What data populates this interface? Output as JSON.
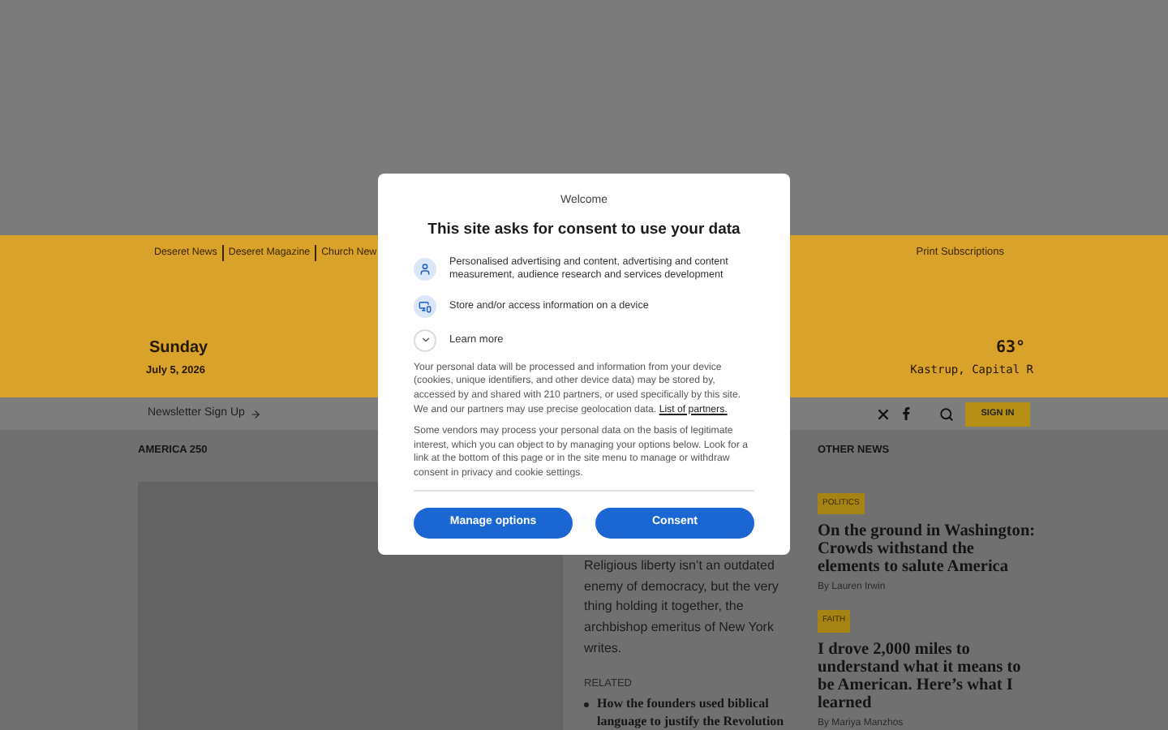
{
  "header": {
    "links": [
      "Deseret News",
      "Deseret Magazine",
      "Church New"
    ],
    "print_link": "Print Subscriptions",
    "day": "Sunday",
    "date": "July 5, 2026",
    "temperature": "63°",
    "location": "Kastrup, Capital R"
  },
  "nav": {
    "newsletter": "Newsletter Sign Up",
    "sign_in": "SIGN IN"
  },
  "main_story": {
    "section": "AMERICA 250",
    "summary": "Religious liberty isn’t an outdated enemy of democracy, but the very thing holding it together, the archbishop emeritus of New York writes.",
    "related_label": "RELATED",
    "related": [
      "How the founders used biblical language to justify the Revolution"
    ]
  },
  "other_news": {
    "title": "OTHER NEWS",
    "stories": [
      {
        "tag": "POLITICS",
        "headline": "On the ground in Washington: Crowds withstand the elements to salute America",
        "byline": "By Lauren Irwin"
      },
      {
        "tag": "FAITH",
        "headline": "I drove 2,000 miles to understand what it means to be American. Here’s what I learned",
        "byline": "By Mariya Manzhos"
      }
    ]
  },
  "consent": {
    "eyebrow": "Welcome",
    "title": "This site asks for consent to use your data",
    "purposes": [
      {
        "kind": "person",
        "text": "Personalised advertising and content, advertising and content measurement, audience research and services development"
      },
      {
        "kind": "device",
        "text": "Store and/or access information on a device"
      }
    ],
    "learn_more": {
      "label": "Learn more",
      "expanded": false
    },
    "paragraph_1": "Your personal data will be processed and information from your device (cookies, unique identifiers, and other device data) may be stored by, accessed by and shared with 210 partners, or used specifically by this site. We and our partners may use precise geolocation data.",
    "partners_link": "List of partners.",
    "paragraph_2": "Some vendors may process your personal data on the basis of legitimate interest, which you can object to by managing your options below. Look for a link at the bottom of this page or in the site menu to manage or withdraw consent in privacy and cookie settings.",
    "buttons": [
      "Manage options",
      "Consent"
    ]
  }
}
